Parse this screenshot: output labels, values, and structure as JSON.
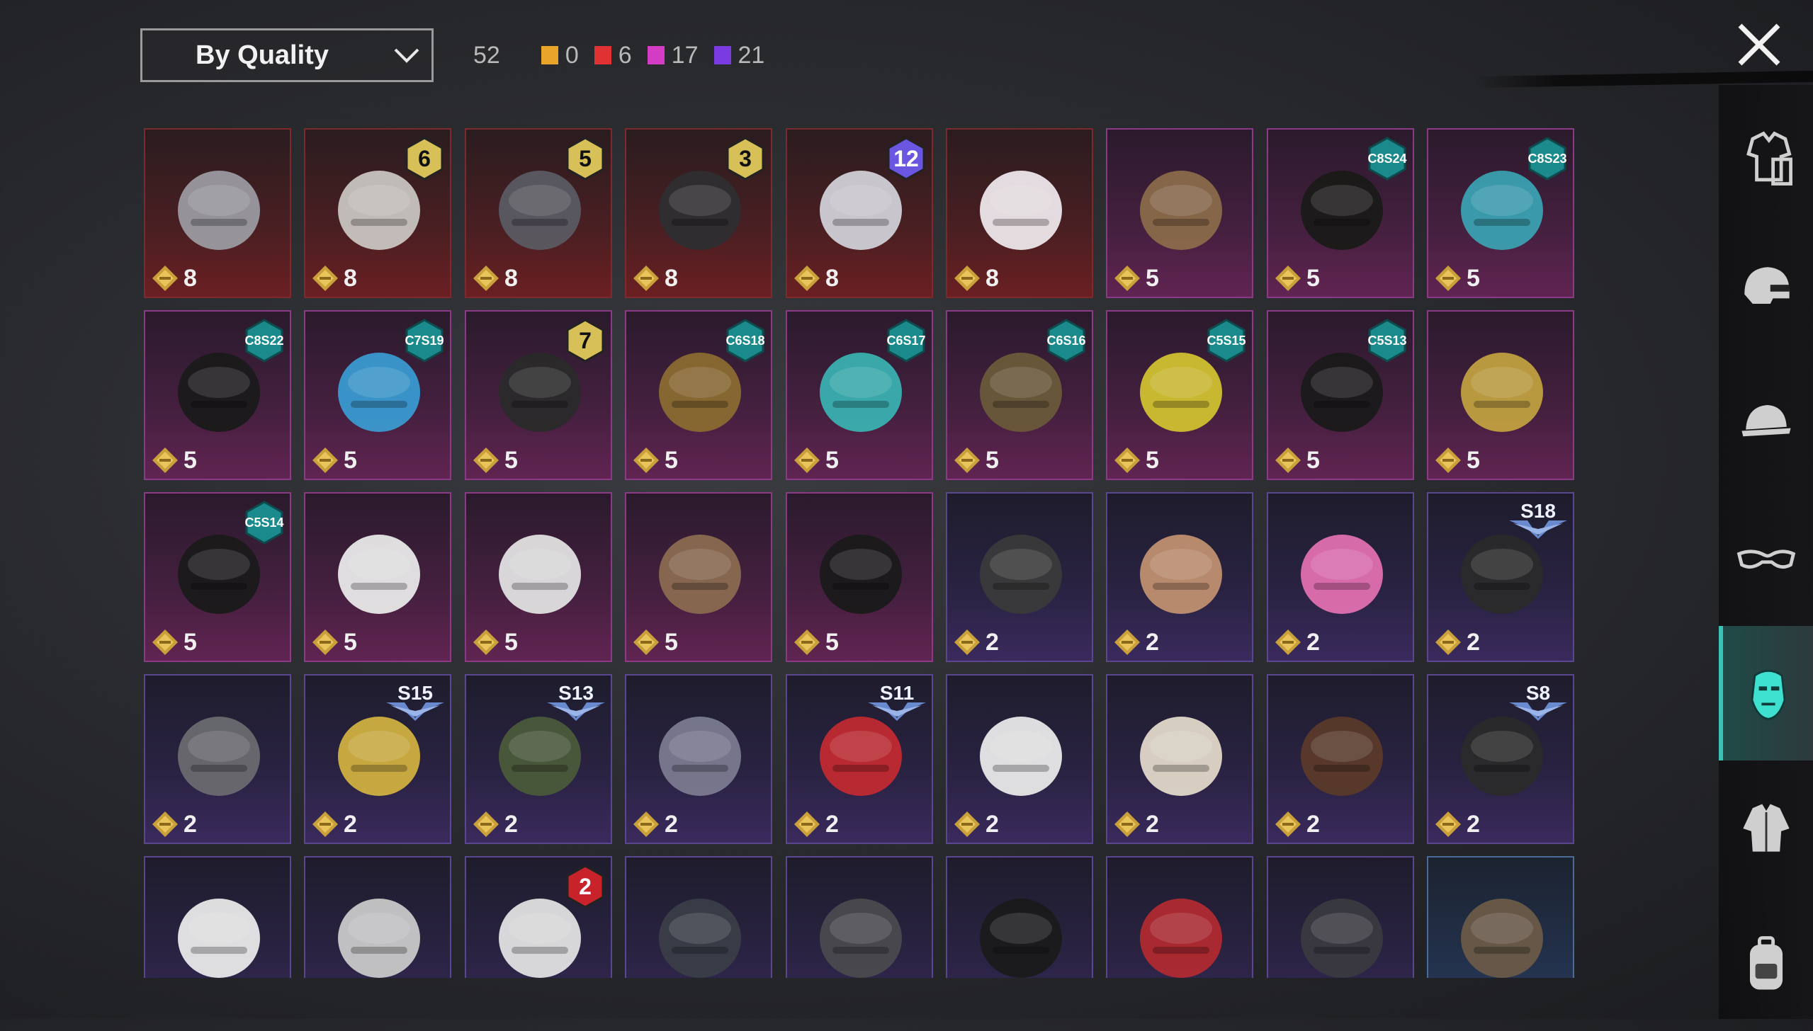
{
  "toolbar": {
    "sort_label": "By Quality",
    "total_count": "52",
    "quality_counts": [
      {
        "value": "0",
        "color": "#e8a52a"
      },
      {
        "value": "6",
        "color": "#e03232"
      },
      {
        "value": "17",
        "color": "#d43cc4"
      },
      {
        "value": "21",
        "color": "#7a3ce0"
      }
    ]
  },
  "items": [
    {
      "tier": "red",
      "cost": "8",
      "badge": "",
      "art": "skull-helmet"
    },
    {
      "tier": "red",
      "cost": "8",
      "badge": "6",
      "art": "plague-mask"
    },
    {
      "tier": "red",
      "cost": "8",
      "badge": "5",
      "art": "gas-mask"
    },
    {
      "tier": "red",
      "cost": "8",
      "badge": "3",
      "art": "wolf-mask"
    },
    {
      "tier": "red",
      "cost": "8",
      "badge": "12",
      "art": "robot-mask"
    },
    {
      "tier": "red",
      "cost": "8",
      "badge": "",
      "art": "cloth-mask"
    },
    {
      "tier": "pink",
      "cost": "5",
      "badge": "",
      "art": "bandana"
    },
    {
      "tier": "pink",
      "cost": "5",
      "badge": "C8S24",
      "art": "visor"
    },
    {
      "tier": "pink",
      "cost": "5",
      "badge": "C8S23",
      "art": "neon-mask"
    },
    {
      "tier": "pink",
      "cost": "5",
      "badge": "C8S22",
      "art": "black-mask"
    },
    {
      "tier": "pink",
      "cost": "5",
      "badge": "C7S19",
      "art": "tiki-mask"
    },
    {
      "tier": "pink",
      "cost": "5",
      "badge": "7",
      "art": "headset"
    },
    {
      "tier": "pink",
      "cost": "5",
      "badge": "C6S18",
      "art": "horn-mask"
    },
    {
      "tier": "pink",
      "cost": "5",
      "badge": "C6S17",
      "art": "teal-mask"
    },
    {
      "tier": "pink",
      "cost": "5",
      "badge": "C6S16",
      "art": "respirator"
    },
    {
      "tier": "pink",
      "cost": "5",
      "badge": "C5S15",
      "art": "respirator-yellow"
    },
    {
      "tier": "pink",
      "cost": "5",
      "badge": "C5S13",
      "art": "gold-mask"
    },
    {
      "tier": "pink",
      "cost": "5",
      "badge": "",
      "art": "gold-helmet"
    },
    {
      "tier": "pink",
      "cost": "5",
      "badge": "C5S14",
      "art": "black-pink-mask"
    },
    {
      "tier": "pink",
      "cost": "5",
      "badge": "",
      "art": "heart-mask"
    },
    {
      "tier": "pink",
      "cost": "5",
      "badge": "",
      "art": "skull-bandana"
    },
    {
      "tier": "pink",
      "cost": "5",
      "badge": "",
      "art": "beak-mask"
    },
    {
      "tier": "pink",
      "cost": "5",
      "badge": "",
      "art": "skull-scarf"
    },
    {
      "tier": "purple",
      "cost": "2",
      "badge": "",
      "art": "red-eye-visor"
    },
    {
      "tier": "purple",
      "cost": "2",
      "badge": "",
      "art": "mammoth-mask"
    },
    {
      "tier": "purple",
      "cost": "2",
      "badge": "",
      "art": "pink-monkey"
    },
    {
      "tier": "purple",
      "cost": "2",
      "badge": "S18",
      "art": "heartbeat-mask"
    },
    {
      "tier": "purple",
      "cost": "2",
      "badge": "",
      "art": "grey-mask"
    },
    {
      "tier": "purple",
      "cost": "2",
      "badge": "S15",
      "art": "demon-mask"
    },
    {
      "tier": "purple",
      "cost": "2",
      "badge": "S13",
      "art": "goggles"
    },
    {
      "tier": "purple",
      "cost": "2",
      "badge": "",
      "art": "robot-visor"
    },
    {
      "tier": "purple",
      "cost": "2",
      "badge": "S11",
      "art": "red-mask"
    },
    {
      "tier": "purple",
      "cost": "2",
      "badge": "",
      "art": "clown-mask"
    },
    {
      "tier": "purple",
      "cost": "2",
      "badge": "",
      "art": "floral-bandana"
    },
    {
      "tier": "purple",
      "cost": "2",
      "badge": "",
      "art": "mustache"
    },
    {
      "tier": "purple",
      "cost": "2",
      "badge": "S8",
      "art": "flame-bandana"
    },
    {
      "tier": "purple",
      "cost": "",
      "badge": "",
      "art": "skull-face-mask"
    },
    {
      "tier": "purple",
      "cost": "",
      "badge": "",
      "art": "grey-cloth-mask"
    },
    {
      "tier": "purple",
      "cost": "",
      "badge": "2",
      "art": "clown-2"
    },
    {
      "tier": "purple",
      "cost": "",
      "badge": "",
      "art": "dark-skull"
    },
    {
      "tier": "purple",
      "cost": "",
      "badge": "",
      "art": "iron-jaw"
    },
    {
      "tier": "purple",
      "cost": "",
      "badge": "",
      "art": "black-bandana"
    },
    {
      "tier": "purple",
      "cost": "",
      "badge": "",
      "art": "red-scarf"
    },
    {
      "tier": "purple",
      "cost": "",
      "badge": "",
      "art": "hockey-mask"
    },
    {
      "tier": "blue",
      "cost": "",
      "badge": "",
      "art": "burlap-mask"
    }
  ],
  "sidebar": [
    {
      "icon": "outfit-icon",
      "active": false
    },
    {
      "icon": "helmet-icon",
      "active": false
    },
    {
      "icon": "cap-icon",
      "active": false
    },
    {
      "icon": "glasses-icon",
      "active": false
    },
    {
      "icon": "mask-icon",
      "active": true
    },
    {
      "icon": "jacket-icon",
      "active": false
    },
    {
      "icon": "bag-icon",
      "active": false
    }
  ]
}
